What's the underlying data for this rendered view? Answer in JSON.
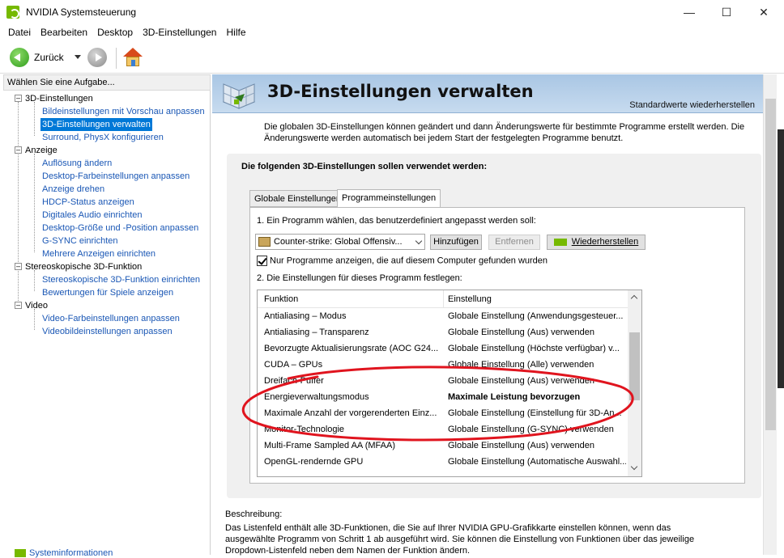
{
  "window": {
    "title": "NVIDIA Systemsteuerung"
  },
  "menu": [
    "Datei",
    "Bearbeiten",
    "Desktop",
    "3D-Einstellungen",
    "Hilfe"
  ],
  "toolbar": {
    "back_label": "Zurück"
  },
  "sidebar": {
    "header": "Wählen Sie eine Aufgabe...",
    "categories": [
      {
        "label": "3D-Einstellungen",
        "items": [
          "Bildeinstellungen mit Vorschau anpassen",
          "3D-Einstellungen verwalten",
          "Surround, PhysX konfigurieren"
        ]
      },
      {
        "label": "Anzeige",
        "items": [
          "Auflösung ändern",
          "Desktop-Farbeinstellungen anpassen",
          "Anzeige drehen",
          "HDCP-Status anzeigen",
          "Digitales Audio einrichten",
          "Desktop-Größe und -Position anpassen",
          "G-SYNC einrichten",
          "Mehrere Anzeigen einrichten"
        ]
      },
      {
        "label": "Stereoskopische 3D-Funktion",
        "items": [
          "Stereoskopische 3D-Funktion einrichten",
          "Bewertungen für Spiele anzeigen"
        ]
      },
      {
        "label": "Video",
        "items": [
          "Video-Farbeinstellungen anpassen",
          "Videobildeinstellungen anpassen"
        ]
      }
    ],
    "selected": "3D-Einstellungen verwalten",
    "footer": "Systeminformationen"
  },
  "main": {
    "title": "3D-Einstellungen verwalten",
    "restore_defaults": "Standardwerte wiederherstellen",
    "description": "Die globalen 3D-Einstellungen können geändert und dann Änderungswerte für bestimmte Programme erstellt werden. Die Änderungswerte werden automatisch bei jedem Start der festgelegten Programme benutzt.",
    "group_title": "Die folgenden 3D-Einstellungen sollen verwendet werden:",
    "tabs": [
      "Globale Einstellungen",
      "Programmeinstellungen"
    ],
    "active_tab": "Programmeinstellungen",
    "step1": "1. Ein Programm wählen, das benutzerdefiniert angepasst werden soll:",
    "program_selected": "Counter-strike: Global Offensiv...",
    "buttons": {
      "add": "Hinzufügen",
      "remove": "Entfernen",
      "restore": "Wiederherstellen"
    },
    "checkbox_label": "Nur Programme anzeigen, die auf diesem Computer gefunden wurden",
    "checkbox_checked": true,
    "step2": "2. Die Einstellungen für dieses Programm festlegen:",
    "columns": [
      "Funktion",
      "Einstellung"
    ],
    "rows": [
      {
        "function": "Antialiasing – Modus",
        "setting": "Globale Einstellung (Anwendungsgesteuer...",
        "bold": false
      },
      {
        "function": "Antialiasing – Transparenz",
        "setting": "Globale Einstellung (Aus) verwenden",
        "bold": false
      },
      {
        "function": "Bevorzugte Aktualisierungsrate (AOC G24...",
        "setting": "Globale Einstellung (Höchste verfügbar) v...",
        "bold": false
      },
      {
        "function": "CUDA – GPUs",
        "setting": "Globale Einstellung (Alle) verwenden",
        "bold": false
      },
      {
        "function": "Dreifach-Puffer",
        "setting": "Globale Einstellung (Aus) verwenden",
        "bold": false
      },
      {
        "function": "Energieverwaltungsmodus",
        "setting": "Maximale Leistung bevorzugen",
        "bold": true
      },
      {
        "function": "Maximale Anzahl der vorgerenderten Einz...",
        "setting": "Globale Einstellung (Einstellung für 3D-An...",
        "bold": false
      },
      {
        "function": "Monitor-Technologie",
        "setting": "Globale Einstellung (G-SYNC) verwenden",
        "bold": false
      },
      {
        "function": "Multi-Frame Sampled AA (MFAA)",
        "setting": "Globale Einstellung (Aus) verwenden",
        "bold": false
      },
      {
        "function": "OpenGL-rendernde GPU",
        "setting": "Globale Einstellung (Automatische Auswahl...",
        "bold": false
      }
    ],
    "description_label": "Beschreibung:",
    "description_text": "Das Listenfeld enthält alle 3D-Funktionen, die Sie auf Ihrer NVIDIA GPU-Grafikkarte einstellen können, wenn das ausgewählte Programm von Schritt 1 ab ausgeführt wird. Sie können die Einstellung von Funktionen über das jeweilige Dropdown-Listenfeld neben dem Namen der Funktion ändern."
  },
  "annotation": {
    "color": "#e0141e"
  }
}
